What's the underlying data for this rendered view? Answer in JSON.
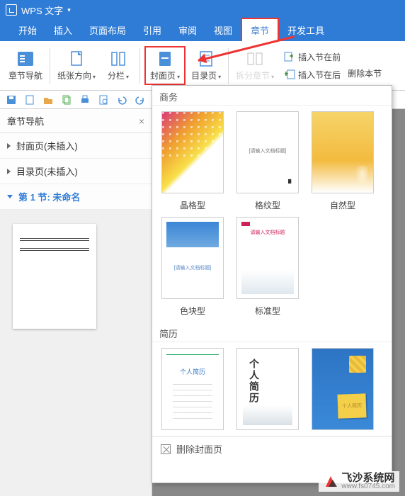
{
  "titlebar": {
    "app_name": "WPS 文字"
  },
  "tabs": {
    "start": "开始",
    "insert": "插入",
    "layout": "页面布局",
    "reference": "引用",
    "review": "审阅",
    "view": "视图",
    "chapter": "章节",
    "dev": "开发工具"
  },
  "ribbon": {
    "nav": "章节导航",
    "orient": "纸张方向",
    "columns": "分栏",
    "cover": "封面页",
    "toc": "目录页",
    "split": "拆分章节",
    "insert_before": "插入节在前",
    "insert_after": "插入节在后",
    "delete": "删除本节"
  },
  "sidebar": {
    "title": "章节导航",
    "items": {
      "cover": "封面页(未插入)",
      "toc": "目录页(未插入)",
      "sec1": "第 1 节: 未命名"
    }
  },
  "dropdown": {
    "sections": {
      "business": "商务",
      "resume": "简历"
    },
    "covers": {
      "crystal": "晶格型",
      "grid": "格纹型",
      "nature": "自然型",
      "block": "色块型",
      "standard": "标准型"
    },
    "thumb_text": {
      "resume1": "个人简历",
      "resume2": "个人简历",
      "resume3": "个人简历"
    },
    "delete_cover": "删除封面页"
  },
  "watermark": {
    "brand": "飞沙系统网",
    "url": "www.fs0745.com"
  }
}
